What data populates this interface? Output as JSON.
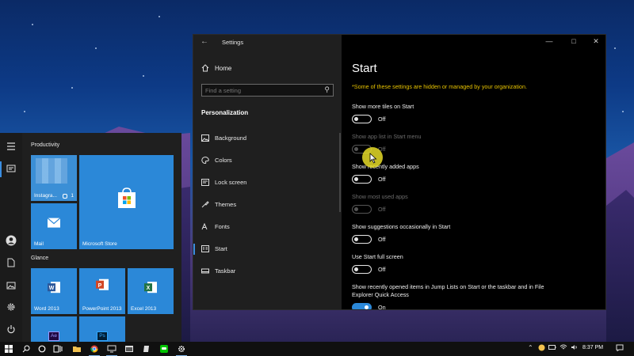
{
  "settings_window": {
    "app_title": "Settings",
    "nav": {
      "home_label": "Home",
      "search_placeholder": "Find a setting",
      "section_title": "Personalization",
      "items": [
        {
          "label": "Background",
          "icon": "picture-icon"
        },
        {
          "label": "Colors",
          "icon": "palette-icon"
        },
        {
          "label": "Lock screen",
          "icon": "lock-screen-icon"
        },
        {
          "label": "Themes",
          "icon": "brush-icon"
        },
        {
          "label": "Fonts",
          "icon": "font-icon"
        },
        {
          "label": "Start",
          "icon": "start-icon",
          "active": true
        },
        {
          "label": "Taskbar",
          "icon": "taskbar-icon"
        }
      ]
    },
    "content": {
      "title": "Start",
      "org_note": "*Some of these settings are hidden or managed by your organization.",
      "settings": [
        {
          "label": "Show more tiles on Start",
          "state": "Off",
          "on": false,
          "enabled": true
        },
        {
          "label": "Show app list in Start menu",
          "state": "Off",
          "on": false,
          "enabled": false
        },
        {
          "label": "Show recently added apps",
          "state": "Off",
          "on": false,
          "enabled": true
        },
        {
          "label": "Show most used apps",
          "state": "Off",
          "on": false,
          "enabled": false
        },
        {
          "label": "Show suggestions occasionally in Start",
          "state": "Off",
          "on": false,
          "enabled": true
        },
        {
          "label": "Use Start full screen",
          "state": "Off",
          "on": false,
          "enabled": true
        },
        {
          "label": "Show recently opened items in Jump Lists on Start or the taskbar and in File Explorer Quick Access",
          "state": "On",
          "on": true,
          "enabled": true
        }
      ]
    }
  },
  "start_menu": {
    "groups": [
      "Productivity",
      "Glance"
    ],
    "tiles": {
      "instagram": {
        "label": "Instagra...",
        "badge": "1"
      },
      "store": {
        "label": "Microsoft Store"
      },
      "mail": {
        "label": "Mail"
      },
      "word": {
        "label": "Word 2013"
      },
      "powerpoint": {
        "label": "PowerPoint 2013"
      },
      "excel": {
        "label": "Excel 2013"
      },
      "ae": {
        "label": "Ae"
      },
      "ps": {
        "label": "Ps"
      }
    },
    "rail_icons": [
      "hamburger-icon",
      "tiles-icon",
      "user-icon",
      "document-icon",
      "pictures-icon",
      "gear-icon",
      "power-icon"
    ]
  },
  "taskbar": {
    "time": "8:37 PM",
    "colors": {
      "accent": "#2b88d8",
      "taskbar_bg": "#101010"
    }
  }
}
